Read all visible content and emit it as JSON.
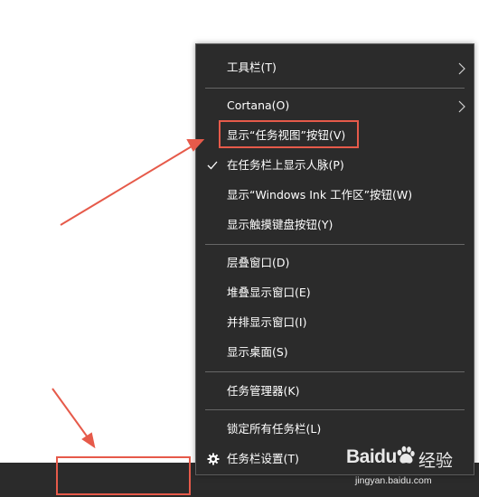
{
  "menu": {
    "items": [
      {
        "label": "工具栏(T)",
        "has_submenu": true
      },
      {
        "label": "Cortana(O)",
        "has_submenu": true
      },
      {
        "label": "显示“任务视图”按钮(V)"
      },
      {
        "label": "在任务栏上显示人脉(P)",
        "checked": true
      },
      {
        "label": "显示“Windows Ink 工作区”按钮(W)"
      },
      {
        "label": "显示触摸键盘按钮(Y)"
      },
      {
        "label": "层叠窗口(D)"
      },
      {
        "label": "堆叠显示窗口(E)"
      },
      {
        "label": "并排显示窗口(I)"
      },
      {
        "label": "显示桌面(S)"
      },
      {
        "label": "任务管理器(K)"
      },
      {
        "label": "锁定所有任务栏(L)"
      },
      {
        "label": "任务栏设置(T)",
        "icon": "gear-icon"
      }
    ]
  },
  "watermark": {
    "brand": "Baidu",
    "suffix": "经验",
    "url": "jingyan.baidu.com"
  },
  "colors": {
    "menu_bg": "#2b2b2b",
    "taskbar_bg": "#2b2b2b",
    "annotation": "#e65a4a",
    "text": "#ffffff"
  }
}
